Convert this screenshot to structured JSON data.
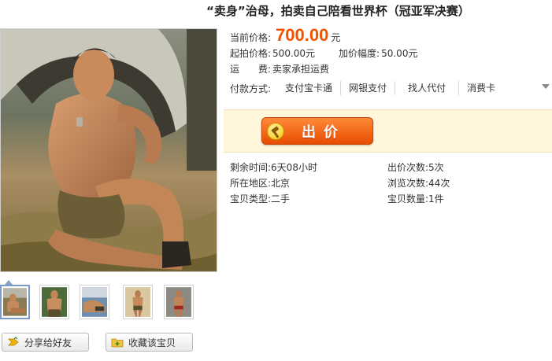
{
  "item": {
    "title": "“卖身”治母，拍卖自己陪看世界杯（冠亚军决赛）"
  },
  "price": {
    "current_label": "当前价格:",
    "current_value": "700.00",
    "currency_unit": "元",
    "start_label": "起拍价格:",
    "start_value": "500.00元",
    "increment_label": "加价幅度:",
    "increment_value": "50.00元",
    "shipping_label": "运　　费:",
    "shipping_value": "卖家承担运费"
  },
  "payment": {
    "label": "付款方式:",
    "options": [
      "支付宝卡通",
      "网银支付",
      "找人代付",
      "消费卡"
    ]
  },
  "bid_button": {
    "label": "出价"
  },
  "stats": {
    "remaining_label": "剩余时间:",
    "remaining_value": "6天08小时",
    "bids_label": "出价次数:",
    "bids_value": "5次",
    "location_label": "所在地区:",
    "location_value": "北京",
    "views_label": "浏览次数:",
    "views_value": "44次",
    "type_label": "宝贝类型:",
    "type_value": "二手",
    "quantity_label": "宝贝数量:",
    "quantity_value": "1件"
  },
  "actions": {
    "share_label": "分享给好友",
    "favorite_label": "收藏该宝贝"
  },
  "colors": {
    "price": "#ee5500",
    "bid_button": "#f06a10",
    "bid_panel": "#fff6dc",
    "thumb_selected_border": "#7a9ac8"
  }
}
